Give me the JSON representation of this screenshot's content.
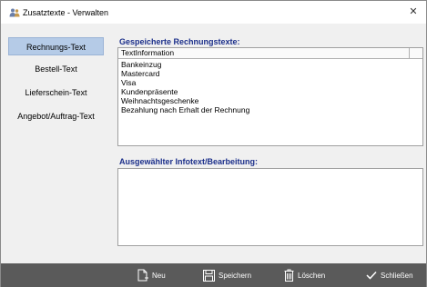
{
  "window": {
    "title": "Zusatztexte - Verwalten",
    "close_glyph": "✕"
  },
  "sidebar": {
    "items": [
      {
        "label": "Rechnungs-Text",
        "active": true
      },
      {
        "label": "Bestell-Text",
        "active": false
      },
      {
        "label": "Lieferschein-Text",
        "active": false
      },
      {
        "label": "Angebot/Auftrag-Text",
        "active": false
      }
    ]
  },
  "saved_texts": {
    "heading": "Gespeicherte Rechnungstexte:",
    "column_header": "TextInformation",
    "rows": [
      "Bankeinzug",
      "Mastercard",
      "Visa",
      "Kundenpräsente",
      "Weihnachtsgeschenke",
      "Bezahlung nach Erhalt der Rechnung"
    ]
  },
  "editor": {
    "heading": "Ausgewählter Infotext/Bearbeitung:",
    "value": ""
  },
  "footer": {
    "new_label": "Neu",
    "save_label": "Speichern",
    "delete_label": "Löschen",
    "close_label": "Schließen"
  },
  "colors": {
    "accent_heading": "#1a2e8a",
    "active_nav": "#b5cbe7",
    "footer_bg": "#5a5a5a"
  }
}
